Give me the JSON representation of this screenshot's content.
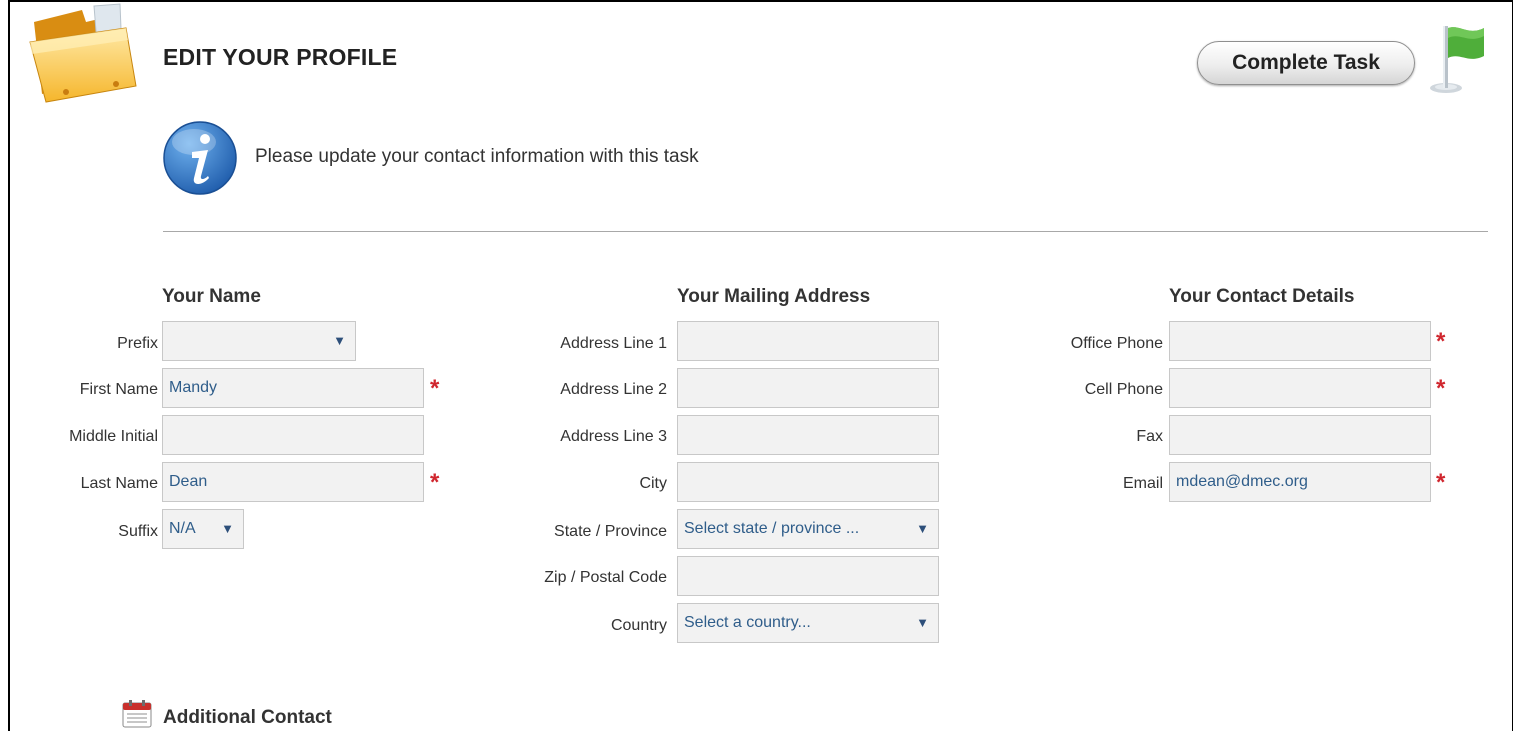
{
  "header": {
    "title": "EDIT YOUR PROFILE",
    "complete_task_label": "Complete Task",
    "folder_icon": "folder-icon",
    "flag_icon": "flag-icon"
  },
  "info": {
    "icon": "info-icon",
    "message": "Please update your contact information with this task"
  },
  "name_section": {
    "title": "Your Name",
    "prefix": {
      "label": "Prefix",
      "value": ""
    },
    "first_name": {
      "label": "First Name",
      "value": "Mandy"
    },
    "middle_initial": {
      "label": "Middle Initial",
      "value": ""
    },
    "last_name": {
      "label": "Last Name",
      "value": "Dean"
    },
    "suffix": {
      "label": "Suffix",
      "value": "N/A"
    }
  },
  "address_section": {
    "title": "Your Mailing Address",
    "line1": {
      "label": "Address Line 1",
      "value": ""
    },
    "line2": {
      "label": "Address Line 2",
      "value": ""
    },
    "line3": {
      "label": "Address Line 3",
      "value": ""
    },
    "city": {
      "label": "City",
      "value": ""
    },
    "state": {
      "label": "State / Province",
      "value": "Select state / province ..."
    },
    "zip": {
      "label": "Zip / Postal Code",
      "value": ""
    },
    "country": {
      "label": "Country",
      "value": "Select a country..."
    }
  },
  "contact_section": {
    "title": "Your Contact Details",
    "office_phone": {
      "label": "Office Phone",
      "value": ""
    },
    "cell_phone": {
      "label": "Cell Phone",
      "value": ""
    },
    "fax": {
      "label": "Fax",
      "value": ""
    },
    "email": {
      "label": "Email",
      "value": "mdean@dmec.org"
    }
  },
  "required_marker": "*",
  "dropdown_caret": "▼",
  "additional": {
    "icon": "calendar-icon",
    "title": "Additional Contact"
  },
  "colors": {
    "required": "#d0262e",
    "field_text": "#2f5d8a",
    "field_bg": "#f2f2f2",
    "flag_green": "#4fae3a",
    "info_blue": "#2b6cb7",
    "folder_orange": "#f3a81f"
  }
}
